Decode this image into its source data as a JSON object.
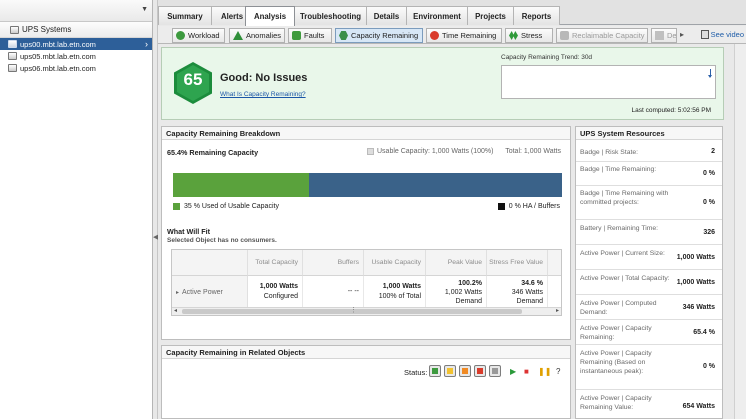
{
  "left_pane": {
    "root_label": "UPS Systems",
    "items": [
      {
        "label": "ups00.mbt.lab.etn.com",
        "selected": true
      },
      {
        "label": "ups05.mbt.lab.etn.com",
        "selected": false
      },
      {
        "label": "ups06.mbt.lab.etn.com",
        "selected": false
      }
    ]
  },
  "main_tabs": [
    {
      "label": "Summary"
    },
    {
      "label": "Alerts"
    },
    {
      "label": "Analysis",
      "active": true
    },
    {
      "label": "Troubleshooting"
    },
    {
      "label": "Details"
    },
    {
      "label": "Environment"
    },
    {
      "label": "Projects"
    },
    {
      "label": "Reports"
    }
  ],
  "sub_tabs": [
    {
      "label": "Workload",
      "icon": "gear-icon"
    },
    {
      "label": "Anomalies",
      "icon": "anomaly-triangle-icon"
    },
    {
      "label": "Faults",
      "icon": "fault-icon"
    },
    {
      "label": "Capacity Remaining",
      "icon": "capacity-hex-icon",
      "active": true
    },
    {
      "label": "Time Remaining",
      "icon": "clock-icon"
    },
    {
      "label": "Stress",
      "icon": "stress-icon"
    },
    {
      "label": "Reclaimable Capacity",
      "icon": "reclaim-icon",
      "disabled": true
    },
    {
      "label": "De",
      "icon": "density-icon",
      "disabled": true
    }
  ],
  "video_link": "See video",
  "summary": {
    "badge_score": "65",
    "status": "Good: No Issues",
    "help_link": "What Is Capacity Remaining?",
    "trend_label": "Capacity Remaining Trend: 30d",
    "last_computed": "Last computed: 5:02:56 PM",
    "badge_color": "#2ea44f"
  },
  "breakdown": {
    "title": "Capacity Remaining Breakdown",
    "remaining_pct": "65.4% Remaining Capacity",
    "usable": "Usable Capacity: 1,000 Watts (100%)",
    "total": "Total: 1,000 Watts",
    "used_fraction": 0.35,
    "used_legend": "35 % Used of Usable Capacity",
    "ha_legend": "0 % HA / Buffers",
    "colors": {
      "used": "#5aa23c",
      "remaining": "#3a6289"
    }
  },
  "what_will_fit": {
    "title": "What Will Fit",
    "note": "Selected Object has no consumers.",
    "columns": [
      "Total Capacity",
      "Buffers",
      "Usable Capacity",
      "Peak Value",
      "Stress Free Value"
    ],
    "row": {
      "name": "Active Power",
      "total_capacity": [
        "1,000 Watts",
        "Configured"
      ],
      "buffers": "-- --",
      "usable_capacity": [
        "1,000 Watts",
        "100% of Total"
      ],
      "peak_value": [
        "100.2%",
        "1,002 Watts",
        "Demand"
      ],
      "stress_free_value": [
        "34.6 %",
        "346 Watts",
        "Demand"
      ]
    }
  },
  "related": {
    "title": "Capacity Remaining in Related Objects",
    "status_label": "Status:",
    "status_filters": [
      "#3d9a3f",
      "#f2c230",
      "#f08a24",
      "#d93b2b",
      "#999999"
    ]
  },
  "resources": {
    "title": "UPS System Resources",
    "rows": [
      {
        "label": "Badge | Risk State:",
        "value": "2"
      },
      {
        "label": "Badge | Time Remaining:",
        "value": "0 %"
      },
      {
        "label": "Badge | Time Remaining with committed projects:",
        "value": "0 %"
      },
      {
        "label": "Battery | Remaining Time:",
        "value": "326"
      },
      {
        "label": "Active Power | Current Size:",
        "value": "1,000 Watts"
      },
      {
        "label": "Active Power | Total Capacity:",
        "value": "1,000 Watts"
      },
      {
        "label": "Active Power | Computed Demand:",
        "value": "346 Watts"
      },
      {
        "label": "Active Power | Capacity Remaining:",
        "value": "65.4 %"
      },
      {
        "label": "Active Power | Capacity Remaining (Based on instantaneous peak):",
        "value": "0 %"
      },
      {
        "label": "Active Power | Capacity Remaining Value:",
        "value": "654 Watts"
      }
    ]
  }
}
